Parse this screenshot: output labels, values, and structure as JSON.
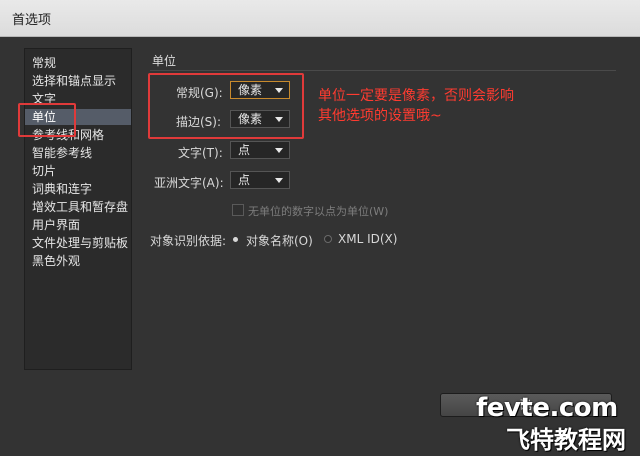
{
  "window": {
    "title": "首选项"
  },
  "sidebar": {
    "items": [
      {
        "label": "常规"
      },
      {
        "label": "选择和锚点显示"
      },
      {
        "label": "文字"
      },
      {
        "label": "单位",
        "selected": true
      },
      {
        "label": "参考线和网格"
      },
      {
        "label": "智能参考线"
      },
      {
        "label": "切片"
      },
      {
        "label": "词典和连字"
      },
      {
        "label": "增效工具和暂存盘"
      },
      {
        "label": "用户界面"
      },
      {
        "label": "文件处理与剪贴板"
      },
      {
        "label": "黑色外观"
      }
    ]
  },
  "units": {
    "section_title": "单位",
    "general": {
      "label": "常规(G):",
      "value": "像素"
    },
    "stroke": {
      "label": "描边(S):",
      "value": "像素"
    },
    "type": {
      "label": "文字(T):",
      "value": "点"
    },
    "asian_type": {
      "label": "亚洲文字(A):",
      "value": "点"
    },
    "no_unit_checkbox": {
      "label": "无单位的数字以点为单位(W)",
      "checked": false,
      "enabled": false
    },
    "identify_objects": {
      "label": "对象识别依据:",
      "options": [
        {
          "label": "对象名称(O)",
          "selected": true
        },
        {
          "label": "XML ID(X)",
          "selected": false
        }
      ]
    }
  },
  "annotation": {
    "line1": "单位一定要是像素，否则会影响",
    "line2": "其他选项的设置哦~",
    "color": "#ff3b30"
  },
  "buttons": {
    "ok_label": "确"
  },
  "watermark": {
    "line1": "fevte.com",
    "line2": "飞特教程网"
  },
  "colors": {
    "accent_highlight": "#e03a3a",
    "selection": "#555c68",
    "focus": "#c88a2d"
  }
}
